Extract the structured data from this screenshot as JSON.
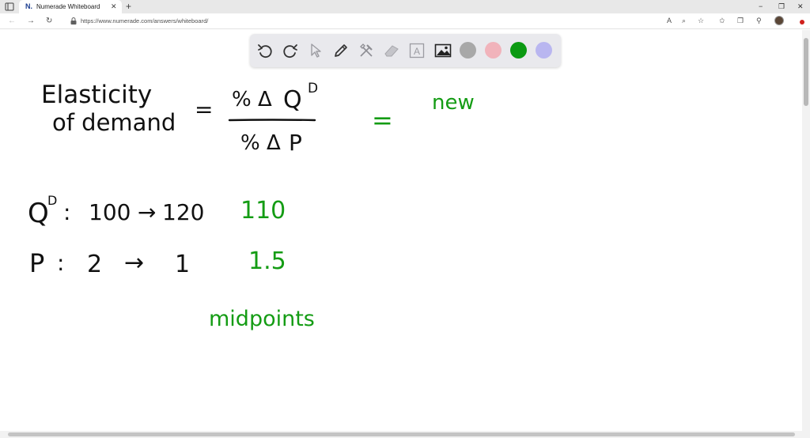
{
  "browser": {
    "tab_title": "Numerade Whiteboard",
    "tab_favicon_text": "N.",
    "tab_close": "✕",
    "new_tab": "+",
    "url": "https://www.numerade.com/answers/whiteboard/",
    "controls": {
      "minimize": "−",
      "restore": "❐",
      "close": "✕"
    }
  },
  "toolbar": {
    "tools": [
      "undo-icon",
      "redo-icon",
      "pointer-icon",
      "pen-icon",
      "tools-icon",
      "eraser-icon",
      "text-icon",
      "image-icon"
    ],
    "text_tool_glyph": "A",
    "colors": [
      "#a8a8a8",
      "#f1b3bb",
      "#0b9a12",
      "#b9b6f0"
    ],
    "selected_color": "#0b9a12"
  },
  "board": {
    "ink_black": "#111111",
    "ink_green": "#149c14",
    "line1": "Elasticity",
    "line2": "of demand",
    "equals1": "=",
    "numerator_pct": "%",
    "numerator_delta": "Δ",
    "numerator_q": "Q",
    "numerator_sup": "D",
    "denominator_pct": "%",
    "denominator_delta": "Δ",
    "denominator_p": "P",
    "equals2": "=",
    "new_label": "new",
    "qd_q": "Q",
    "qd_sup": "D",
    "qd_colon": ":",
    "qd_from": "100",
    "qd_arrow": "→",
    "qd_to": "120",
    "qd_mid": "110",
    "p_label": "P",
    "p_colon": ":",
    "p_from": "2",
    "p_arrow": "→",
    "p_to": "1",
    "p_mid": "1.5",
    "midpoints_label": "midpoints"
  }
}
